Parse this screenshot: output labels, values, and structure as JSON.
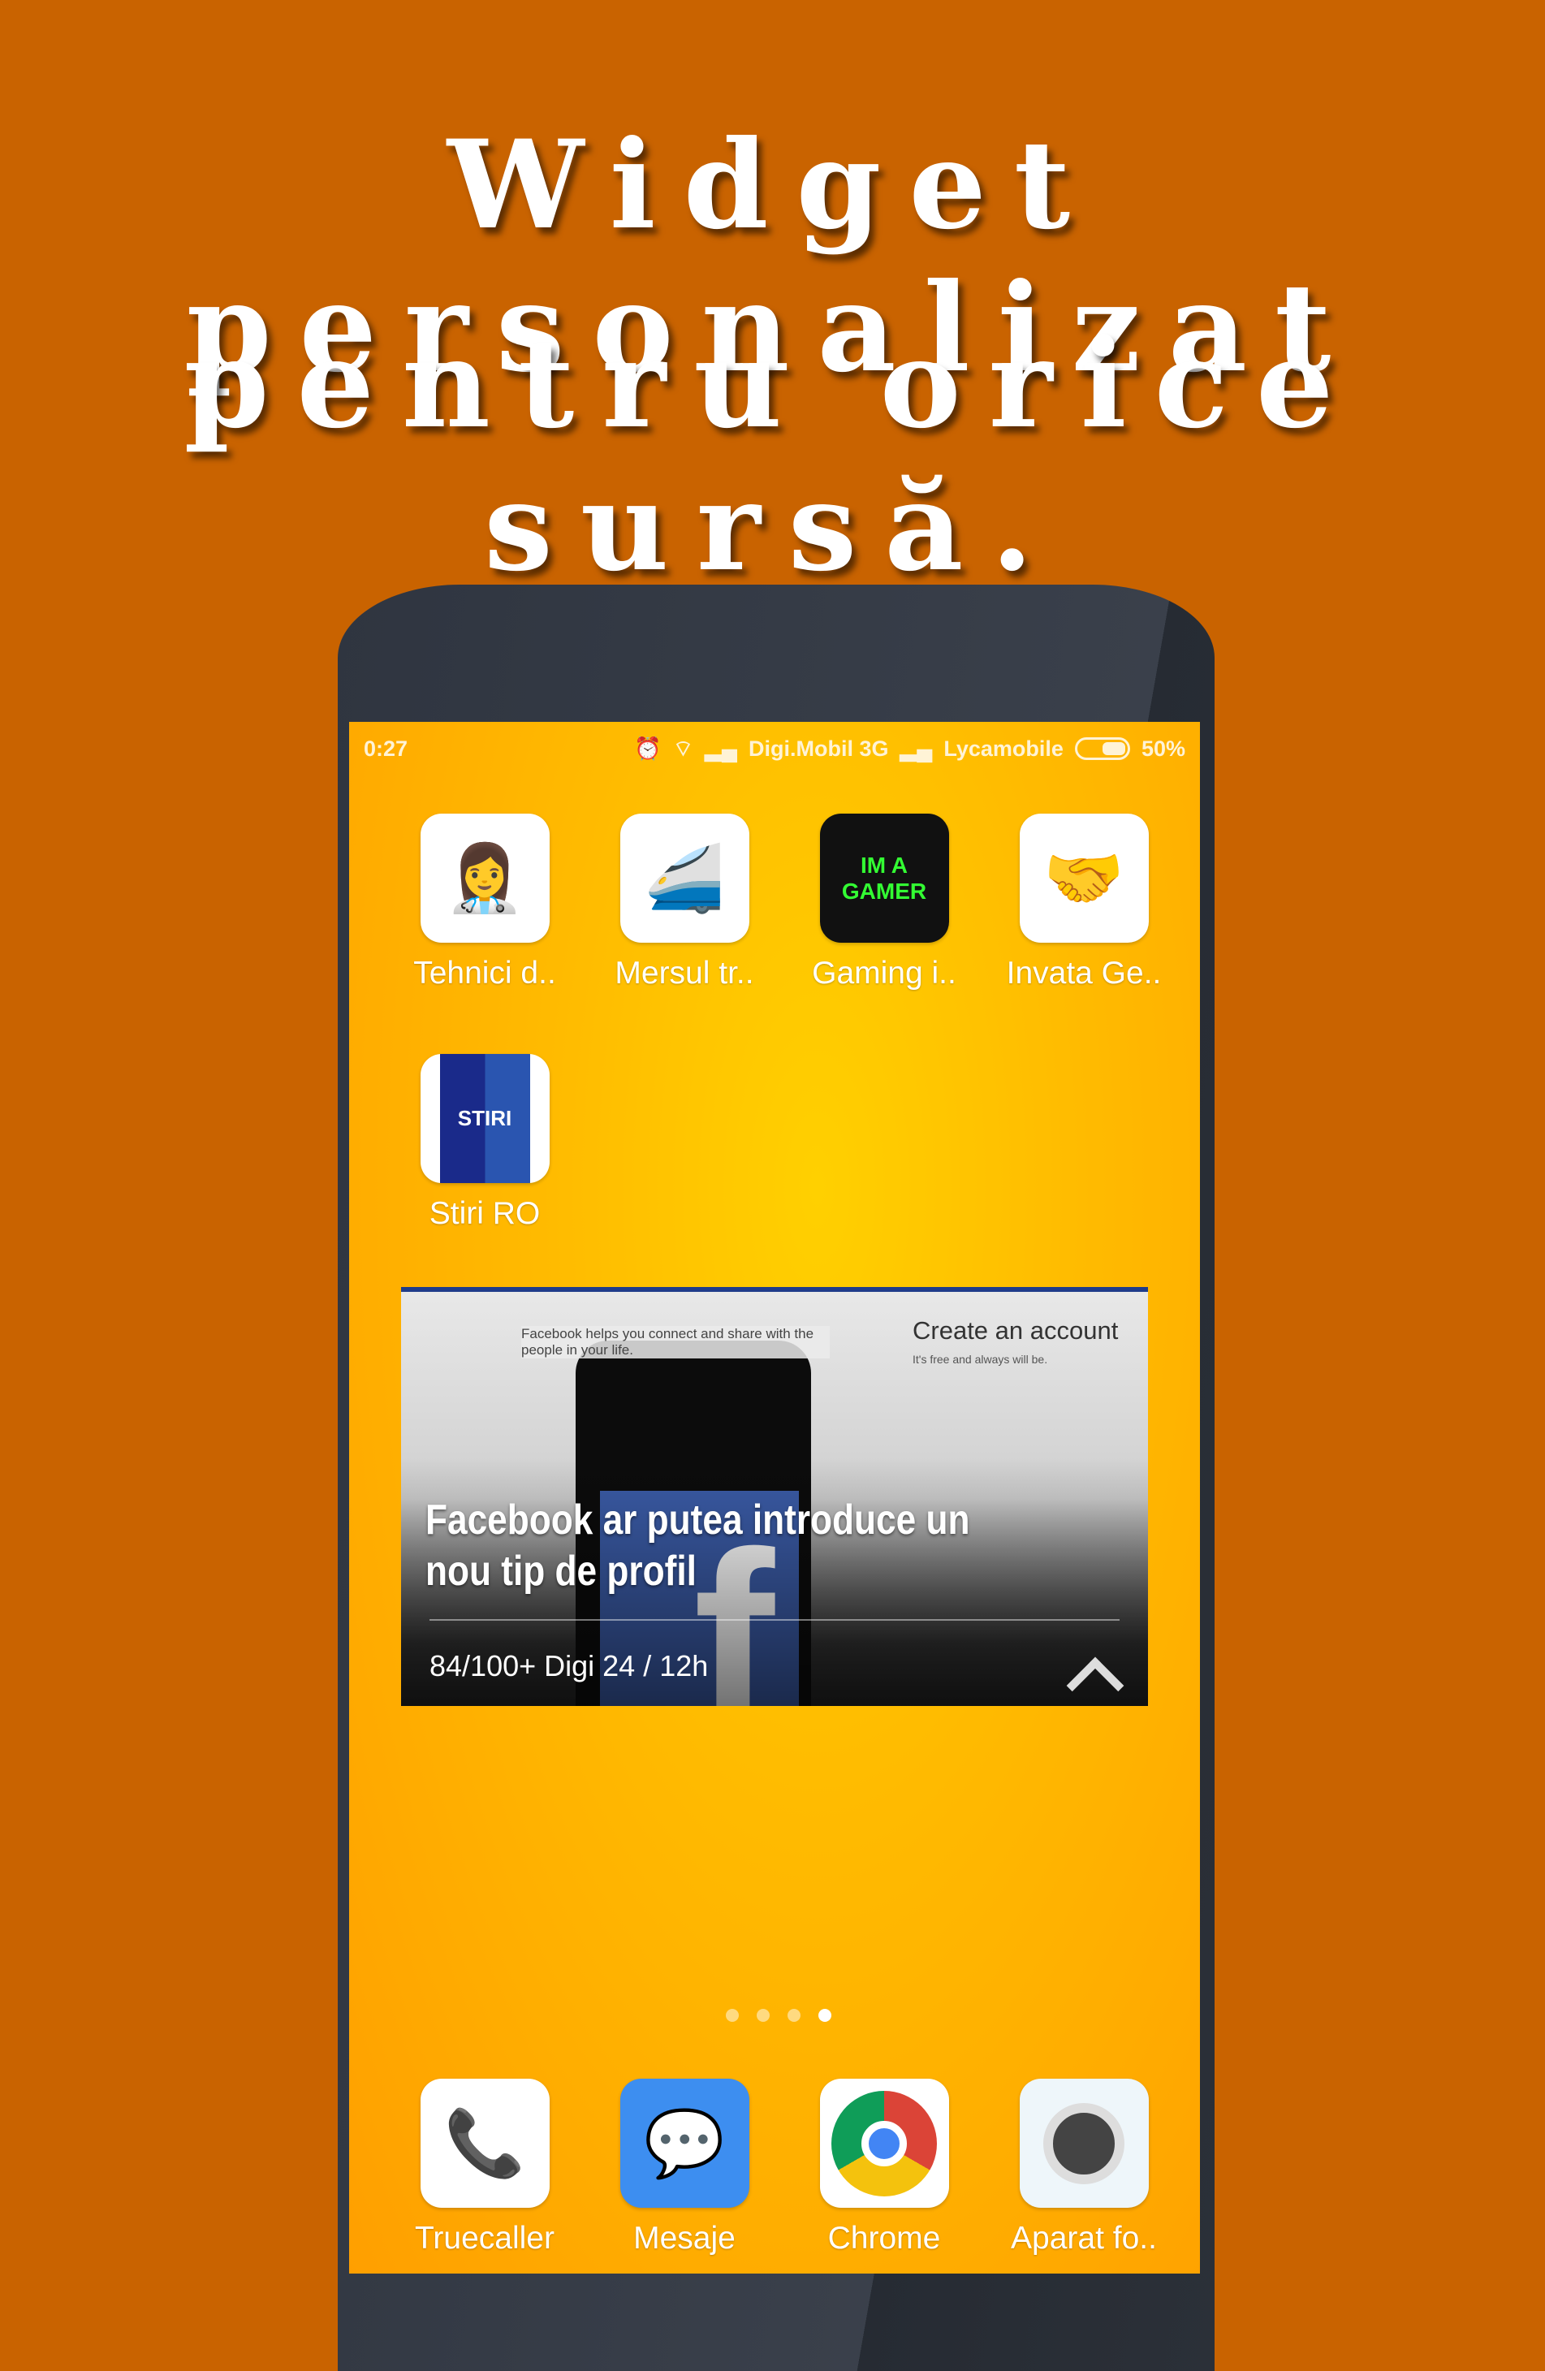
{
  "headline": {
    "line1": "Widget personalizat",
    "line2": "pentru orice sursă."
  },
  "status_bar": {
    "time": "0:27",
    "carrier1": "Digi.Mobil 3G",
    "carrier2": "Lycamobile",
    "battery": "50%",
    "icons": [
      "alarm-icon",
      "wifi-icon",
      "signal-icon",
      "battery-icon"
    ]
  },
  "apps": [
    {
      "label": "Tehnici d..",
      "icon": "nurse-icon"
    },
    {
      "label": "Mersul tr..",
      "icon": "train-icon"
    },
    {
      "label": "Gaming i..",
      "icon": "gamer-icon",
      "icon_text": "IM A GAMER"
    },
    {
      "label": "Invata Ge..",
      "icon": "handshake-flags-icon"
    },
    {
      "label": "Stiri RO",
      "icon": "stiri-icon",
      "icon_text": "STIRI"
    }
  ],
  "widget": {
    "title": "Facebook ar putea introduce un nou tip de profil",
    "meta": "84/100+  Digi 24 / 12h",
    "image_text": {
      "create": "Create an account",
      "free": "It's free and always will be.",
      "helps": "Facebook helps you connect and share with the people in your life."
    }
  },
  "page_indicator": {
    "count": 4,
    "active": 4
  },
  "dock": [
    {
      "label": "Truecaller",
      "icon": "phone-icon"
    },
    {
      "label": "Mesaje",
      "icon": "message-icon"
    },
    {
      "label": "Chrome",
      "icon": "chrome-icon"
    },
    {
      "label": "Aparat fo..",
      "icon": "camera-icon"
    }
  ],
  "colors": {
    "background": "#c96300",
    "screen": "#ffb300",
    "mesaje": "#3d8ef0"
  }
}
